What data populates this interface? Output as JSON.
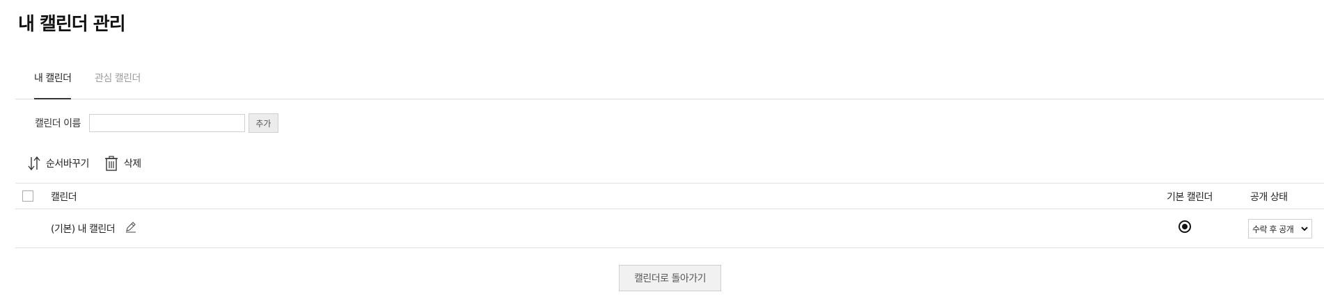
{
  "page": {
    "title": "내 캘린더 관리"
  },
  "tabs": [
    {
      "label": "내 캘린더",
      "active": true
    },
    {
      "label": "관심 캘린더",
      "active": false
    }
  ],
  "add_form": {
    "label": "캘린더 이름",
    "input_value": "",
    "add_label": "추가"
  },
  "toolbar": {
    "reorder": {
      "label": "순서바꾸기",
      "icon": "sort-arrows-icon"
    },
    "delete": {
      "label": "삭제",
      "icon": "trash-icon"
    }
  },
  "table": {
    "headers": {
      "calendar": "캘린더",
      "default": "기본 캘린더",
      "visibility": "공개 상태"
    },
    "rows": [
      {
        "name": "(기본) 내 캘린더",
        "is_default": true,
        "visibility": "수락 후 공개"
      }
    ]
  },
  "footer": {
    "back_label": "캘린더로 돌아가기"
  }
}
